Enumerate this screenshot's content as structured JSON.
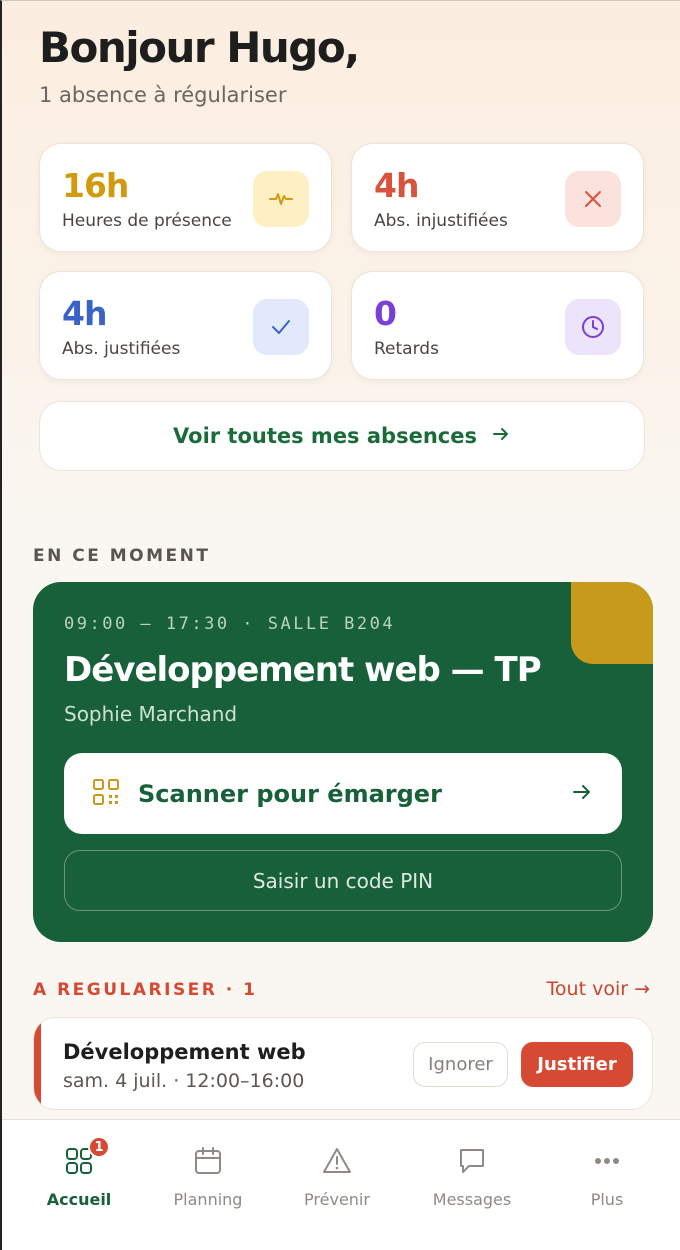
{
  "header": {
    "greeting": "Bonjour Hugo,",
    "subtitle": "1 absence à régulariser"
  },
  "stats": [
    {
      "value": "16h",
      "label": "Heures de présence",
      "icon": "activity-icon",
      "color": "#d29a0e",
      "icon_bg": "#fdf0c4"
    },
    {
      "value": "4h",
      "label": "Abs. injustifiées",
      "icon": "close-icon",
      "color": "#d9533c",
      "icon_bg": "#fbe2dd"
    },
    {
      "value": "4h",
      "label": "Abs. justifiées",
      "icon": "check-icon",
      "color": "#3a63c9",
      "icon_bg": "#e1e9fb"
    },
    {
      "value": "0",
      "label": "Retards",
      "icon": "clock-icon",
      "color": "#7a3fd6",
      "icon_bg": "#ece4fb"
    }
  ],
  "all_absences_label": "Voir toutes mes absences",
  "current": {
    "heading": "EN CE MOMENT",
    "meta": "09:00 — 17:30 · SALLE B204",
    "course": "Développement web — TP",
    "teacher": "Sophie Marchand",
    "scan_label": "Scanner pour émarger",
    "pin_label": "Saisir un code PIN"
  },
  "to_regularize": {
    "heading": "A REGULARISER · 1",
    "see_all": "Tout voir →",
    "items": [
      {
        "course": "Développement web",
        "date": "sam. 4 juil. · 12:00–16:00",
        "ignore_label": "Ignorer",
        "justify_label": "Justifier"
      }
    ]
  },
  "tabbar": {
    "tabs": [
      {
        "label": "Accueil",
        "icon": "home-grid-icon",
        "active": true,
        "badge": "1"
      },
      {
        "label": "Planning",
        "icon": "calendar-icon"
      },
      {
        "label": "Prévenir",
        "icon": "warning-icon"
      },
      {
        "label": "Messages",
        "icon": "message-icon"
      },
      {
        "label": "Plus",
        "icon": "more-icon"
      }
    ]
  },
  "colors": {
    "brand_green": "#17603a",
    "accent_gold": "#c79a1b",
    "alert_red": "#d64a33"
  }
}
